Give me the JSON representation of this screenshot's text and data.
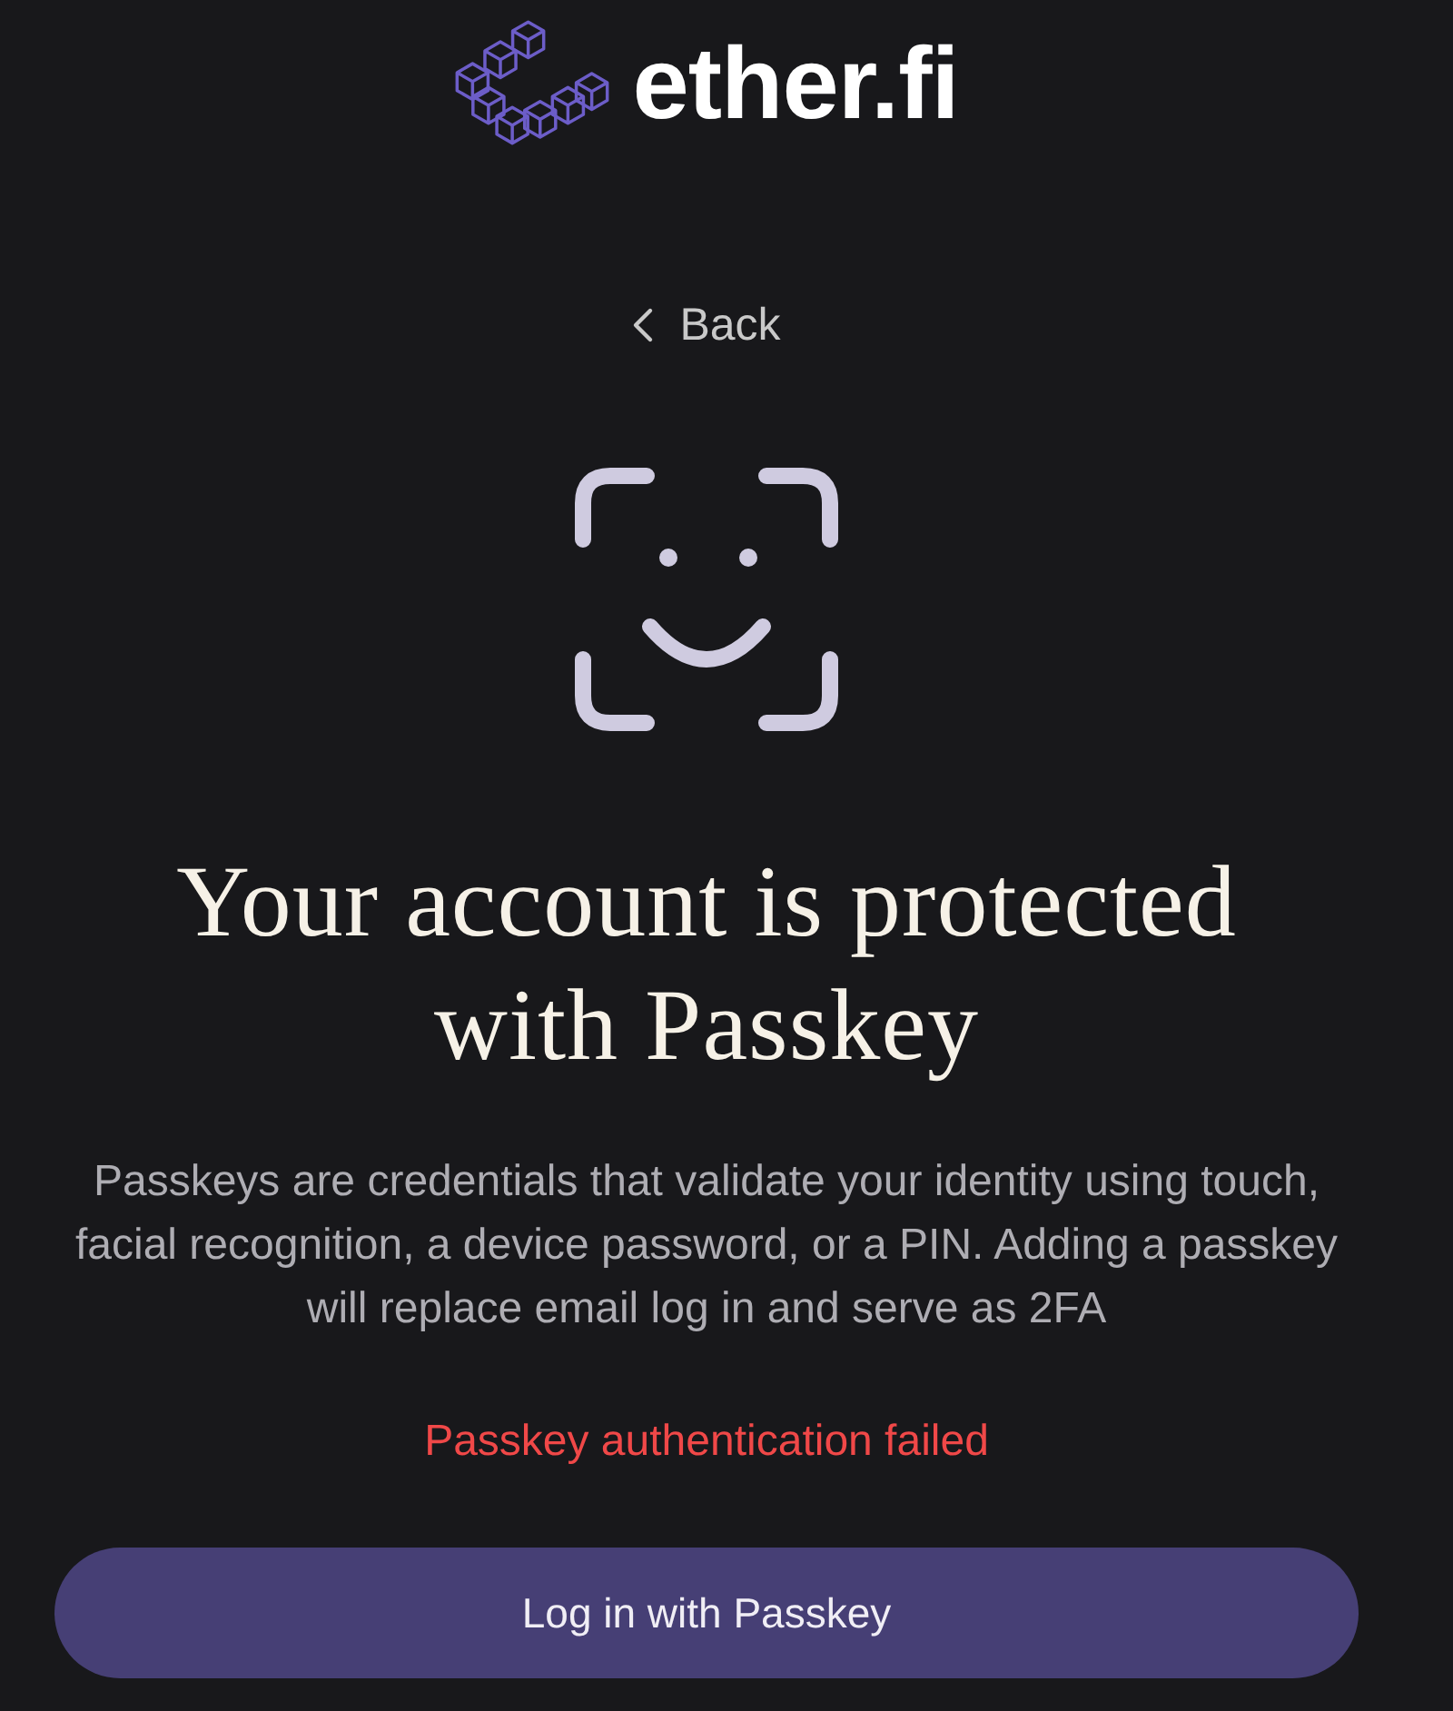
{
  "logo": {
    "wordmark": "ether.fi"
  },
  "back_button": {
    "label": "Back"
  },
  "heading": "Your account is protected with Passkey",
  "description": "Passkeys are credentials that validate your identity using touch, facial recognition, a device password, or a PIN. Adding a passkey will replace email log in and serve as 2FA",
  "error_message": "Passkey authentication failed",
  "primary_button": {
    "label": "Log in with Passkey"
  }
}
